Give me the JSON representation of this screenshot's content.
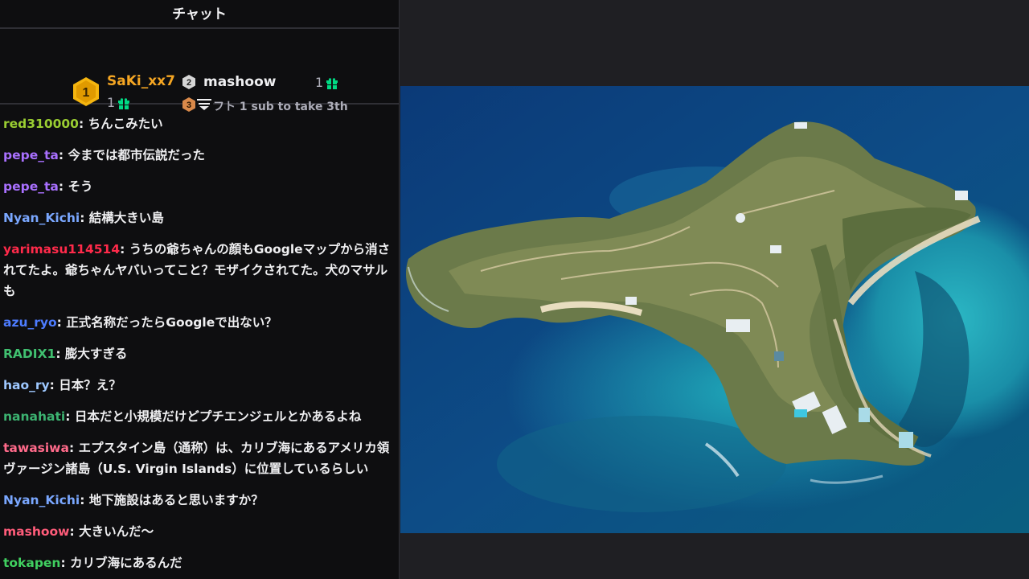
{
  "chat": {
    "title": "チャット",
    "leaderboard": {
      "first": {
        "rank": "1",
        "name": "SaKi_xx7",
        "count": "1"
      },
      "second": {
        "rank": "2",
        "name": "mashoow",
        "count": "1"
      },
      "third": {
        "rank": "3",
        "text": "ギフト 1 sub to take 3th"
      }
    },
    "messages": [
      {
        "user": "red310000",
        "color": "#9acd32",
        "text": "ちんこみたい"
      },
      {
        "user": "pepe_ta",
        "color": "#a970ff",
        "text": "今までは都市伝説だった"
      },
      {
        "user": "pepe_ta",
        "color": "#a970ff",
        "text": "そう"
      },
      {
        "user": "Nyan_Kichi",
        "color": "#7aa7ff",
        "text": "結構大きい島"
      },
      {
        "user": "yarimasu114514",
        "color": "#ff2a4a",
        "text": "うちの爺ちゃんの顔もGoogleマップから消されてたよ。爺ちゃんヤバいってこと？モザイクされてた。犬のマサルも"
      },
      {
        "user": "azu_ryo",
        "color": "#4d7cff",
        "text": "正式名称だったらGoogleで出ない？"
      },
      {
        "user": "RADIX1",
        "color": "#40c070",
        "text": "膨大すぎる"
      },
      {
        "user": "hao_ry",
        "color": "#9ec8ff",
        "text": "日本？え？"
      },
      {
        "user": "nanahati",
        "color": "#3cb371",
        "text": "日本だと小規模だけどプチエンジェルとかあるよね"
      },
      {
        "user": "tawasiwa",
        "color": "#ff6a8a",
        "text": "エプスタイン島（通称）は、カリブ海にあるアメリカ領ヴァージン諸島（U.S. Virgin Islands）に位置しているらしい"
      },
      {
        "user": "Nyan_Kichi",
        "color": "#7aa7ff",
        "text": "地下施設はあると思いますか？"
      },
      {
        "user": "mashoow",
        "color": "#ff5c7a",
        "text": "大きいんだ〜"
      },
      {
        "user": "tokapen",
        "color": "#40d060",
        "text": "カリブ海にあるんだ"
      }
    ]
  },
  "icons": {
    "gold_medal": "medal-icon",
    "gift": "gift-icon",
    "collapse": "collapse-icon"
  },
  "colors": {
    "first_place": "#f5a623",
    "gift_green": "#00db84"
  }
}
